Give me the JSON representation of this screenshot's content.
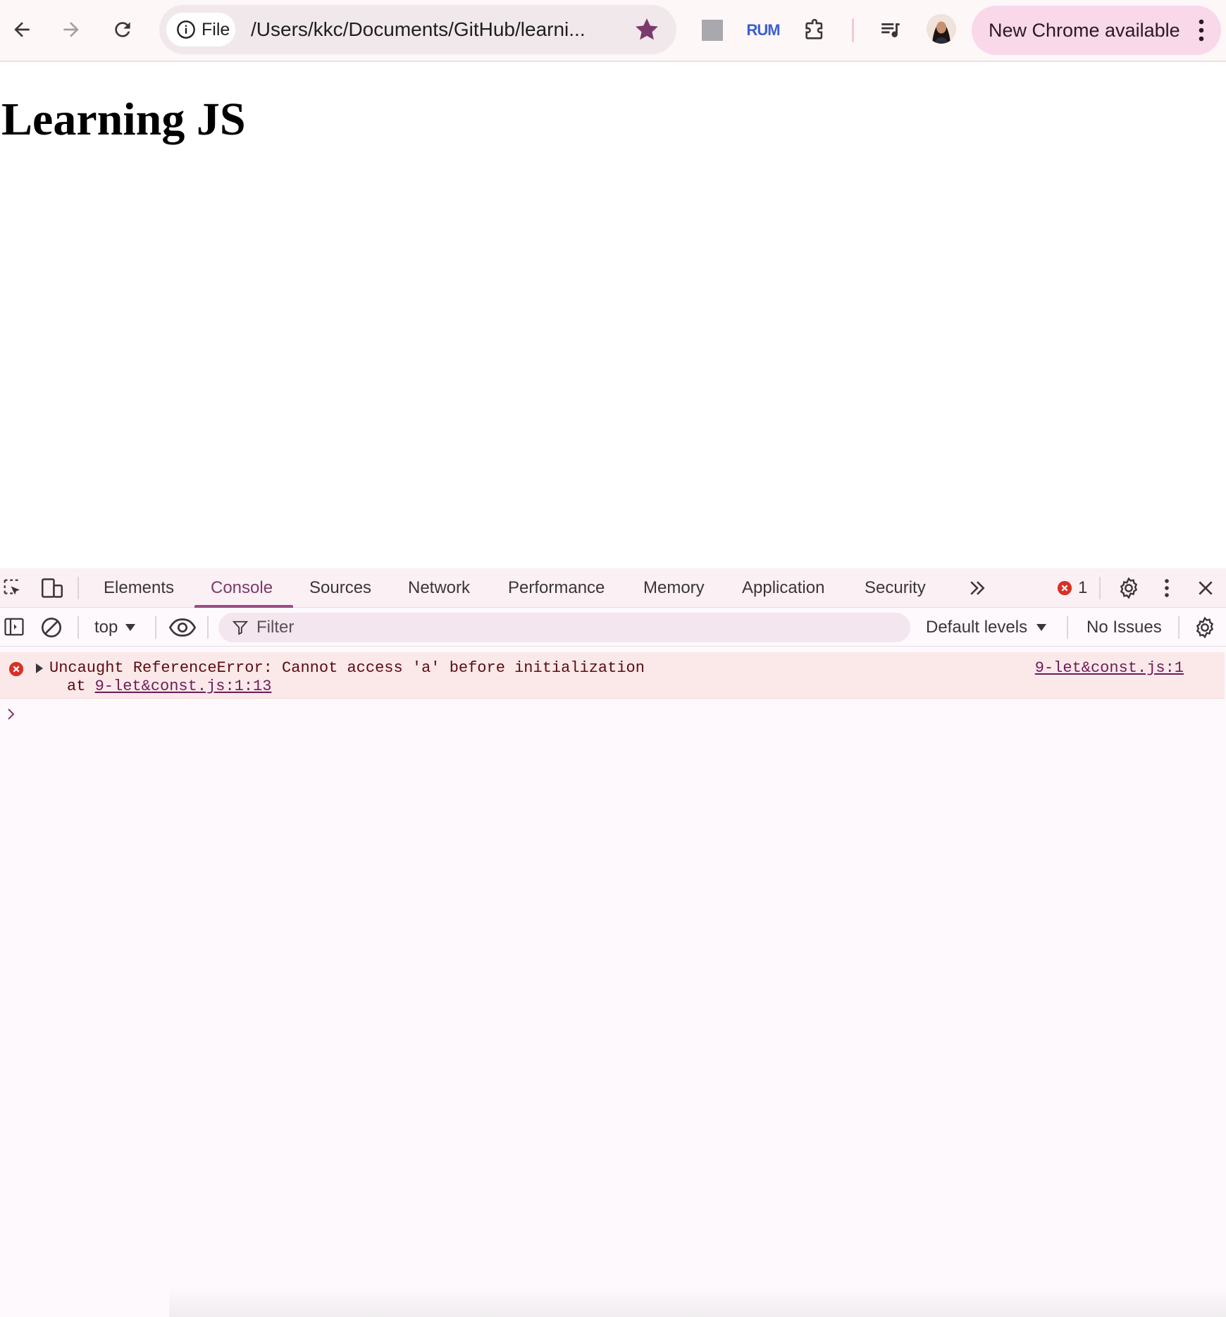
{
  "browser": {
    "site_chip_label": "File",
    "url": "/Users/kkc/Documents/GitHub/learni...",
    "extension_rum_label": "RUM",
    "update_button_label": "New Chrome available",
    "icons": [
      "back-icon",
      "forward-icon",
      "reload-icon",
      "info-icon",
      "star-icon",
      "extension-square-icon",
      "rum-extension-icon",
      "puzzle-icon",
      "media-playlist-icon",
      "profile-avatar",
      "more-vert-icon"
    ],
    "accent_color": "#7c3a6c",
    "update_pill_color": "#f9d8ea"
  },
  "page": {
    "heading": "Learning JS"
  },
  "devtools": {
    "tabs": [
      {
        "label": "Elements",
        "active": false
      },
      {
        "label": "Console",
        "active": true
      },
      {
        "label": "Sources",
        "active": false
      },
      {
        "label": "Network",
        "active": false
      },
      {
        "label": "Performance",
        "active": false
      },
      {
        "label": "Memory",
        "active": false
      },
      {
        "label": "Application",
        "active": false
      },
      {
        "label": "Security",
        "active": false
      }
    ],
    "error_count": "1",
    "console_toolbar": {
      "context": "top",
      "filter_placeholder": "Filter",
      "levels": "Default levels",
      "issues": "No Issues"
    },
    "messages": [
      {
        "level": "error",
        "text": "Uncaught ReferenceError: Cannot access 'a' before initialization",
        "stack_prefix": "at ",
        "stack_link": "9-let&const.js:1:13",
        "source": "9-let&const.js:1"
      }
    ],
    "prompt_symbol": "›",
    "error_color": "#d93025"
  }
}
